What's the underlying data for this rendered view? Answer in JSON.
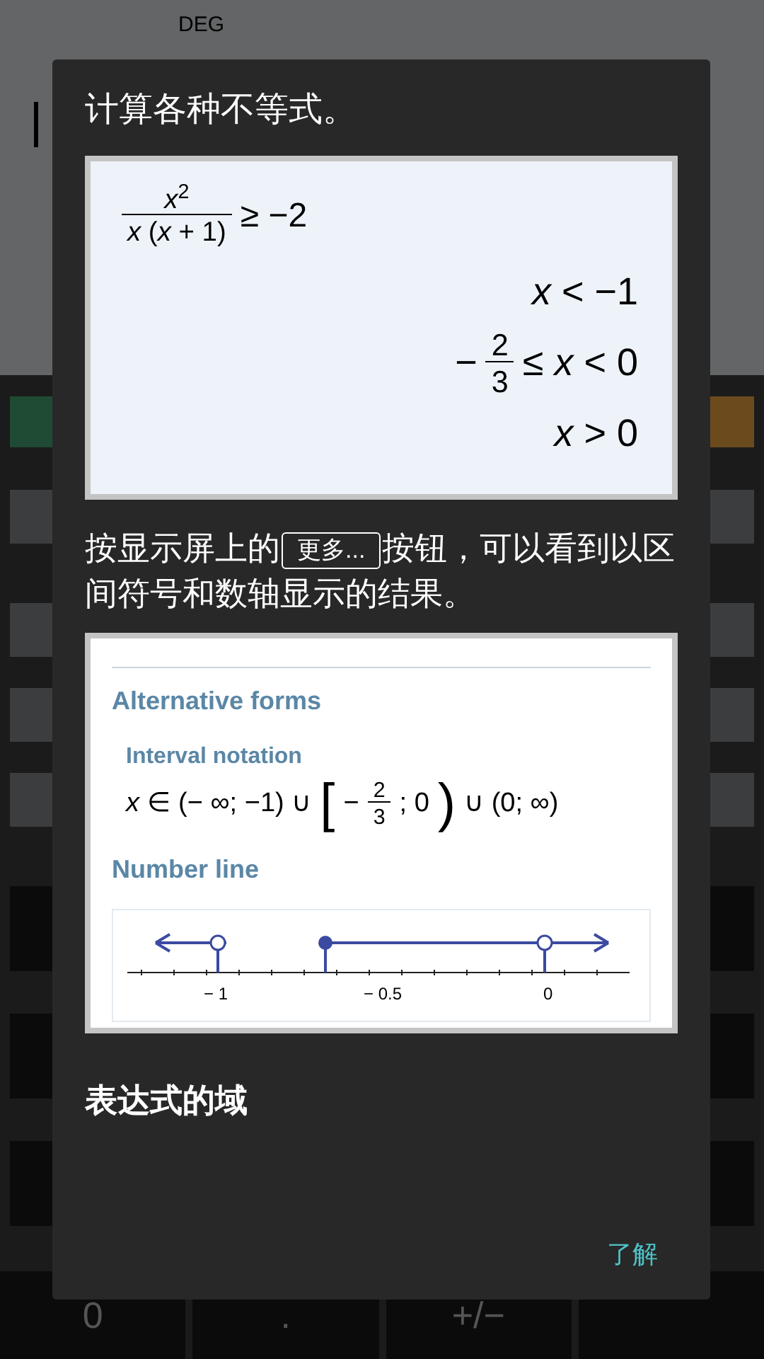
{
  "status": {
    "angle_mode": "DEG"
  },
  "keypad": {
    "bottom_row": [
      "0",
      ".",
      "+/−"
    ]
  },
  "dialog": {
    "intro": "计算各种不等式。",
    "example": {
      "expression": [
        {
          "kind": "frac",
          "num": "*x*$^{2}$",
          "den": "*x* (*x* + 1)"
        },
        {
          "kind": "text",
          "text": "≥ −2"
        }
      ],
      "results": [
        [
          {
            "kind": "text",
            "text": "*x* < −1"
          }
        ],
        [
          {
            "kind": "text",
            "text": "−"
          },
          {
            "kind": "frac",
            "num": "2",
            "den": "3"
          },
          {
            "kind": "text",
            "text": "≤ *x* < 0"
          }
        ],
        [
          {
            "kind": "text",
            "text": "*x* > 0"
          }
        ]
      ]
    },
    "hint": {
      "before": "按显示屏上的",
      "button": "更多...",
      "after": "按钮，可以看到以区间符号和数轴显示的结果。"
    },
    "result_view": {
      "title": "Alternative forms",
      "interval_title": "Interval notation",
      "interval": [
        {
          "kind": "text",
          "text": "*x* ∈ (− ∞; −1) ∪"
        },
        {
          "kind": "big",
          "text": "["
        },
        {
          "kind": "text",
          "text": "−"
        },
        {
          "kind": "frac",
          "num": "2",
          "den": "3"
        },
        {
          "kind": "text",
          "text": "; 0"
        },
        {
          "kind": "big",
          "text": ")"
        },
        {
          "kind": "text",
          "text": "∪ (0; ∞)"
        }
      ],
      "number_line_title": "Number line",
      "ticks": [
        "− 1",
        "− 0.5",
        "0"
      ]
    },
    "next_heading": "表达式的域",
    "ok_button": "了解"
  }
}
